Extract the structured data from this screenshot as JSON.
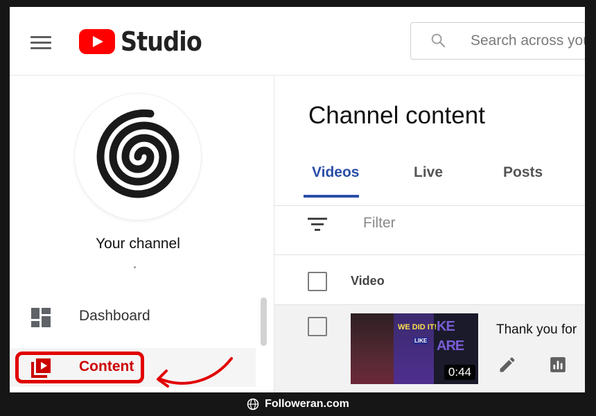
{
  "header": {
    "app_name": "Studio",
    "search_placeholder": "Search across your channel",
    "search_visible": "Search across you"
  },
  "sidebar": {
    "channel_label": "Your channel",
    "items": [
      {
        "label": "Dashboard",
        "icon": "dashboard-icon"
      },
      {
        "label": "Content",
        "icon": "content-icon",
        "active": true
      }
    ]
  },
  "main": {
    "title": "Channel content",
    "tabs": [
      {
        "label": "Videos",
        "active": true
      },
      {
        "label": "Live"
      },
      {
        "label": "Posts"
      }
    ],
    "filter_label": "Filter",
    "column_header": "Video",
    "rows": [
      {
        "title": "Thank you for",
        "duration": "0:44",
        "thumb_texts": [
          "WE DID IT!",
          "KE",
          "ARE",
          "LIKE"
        ]
      }
    ]
  },
  "footer": {
    "watermark": "Followeran.com"
  },
  "colors": {
    "brand_red": "#ff0000",
    "highlight_red": "#e10000",
    "tab_active": "#2a4ea8"
  }
}
